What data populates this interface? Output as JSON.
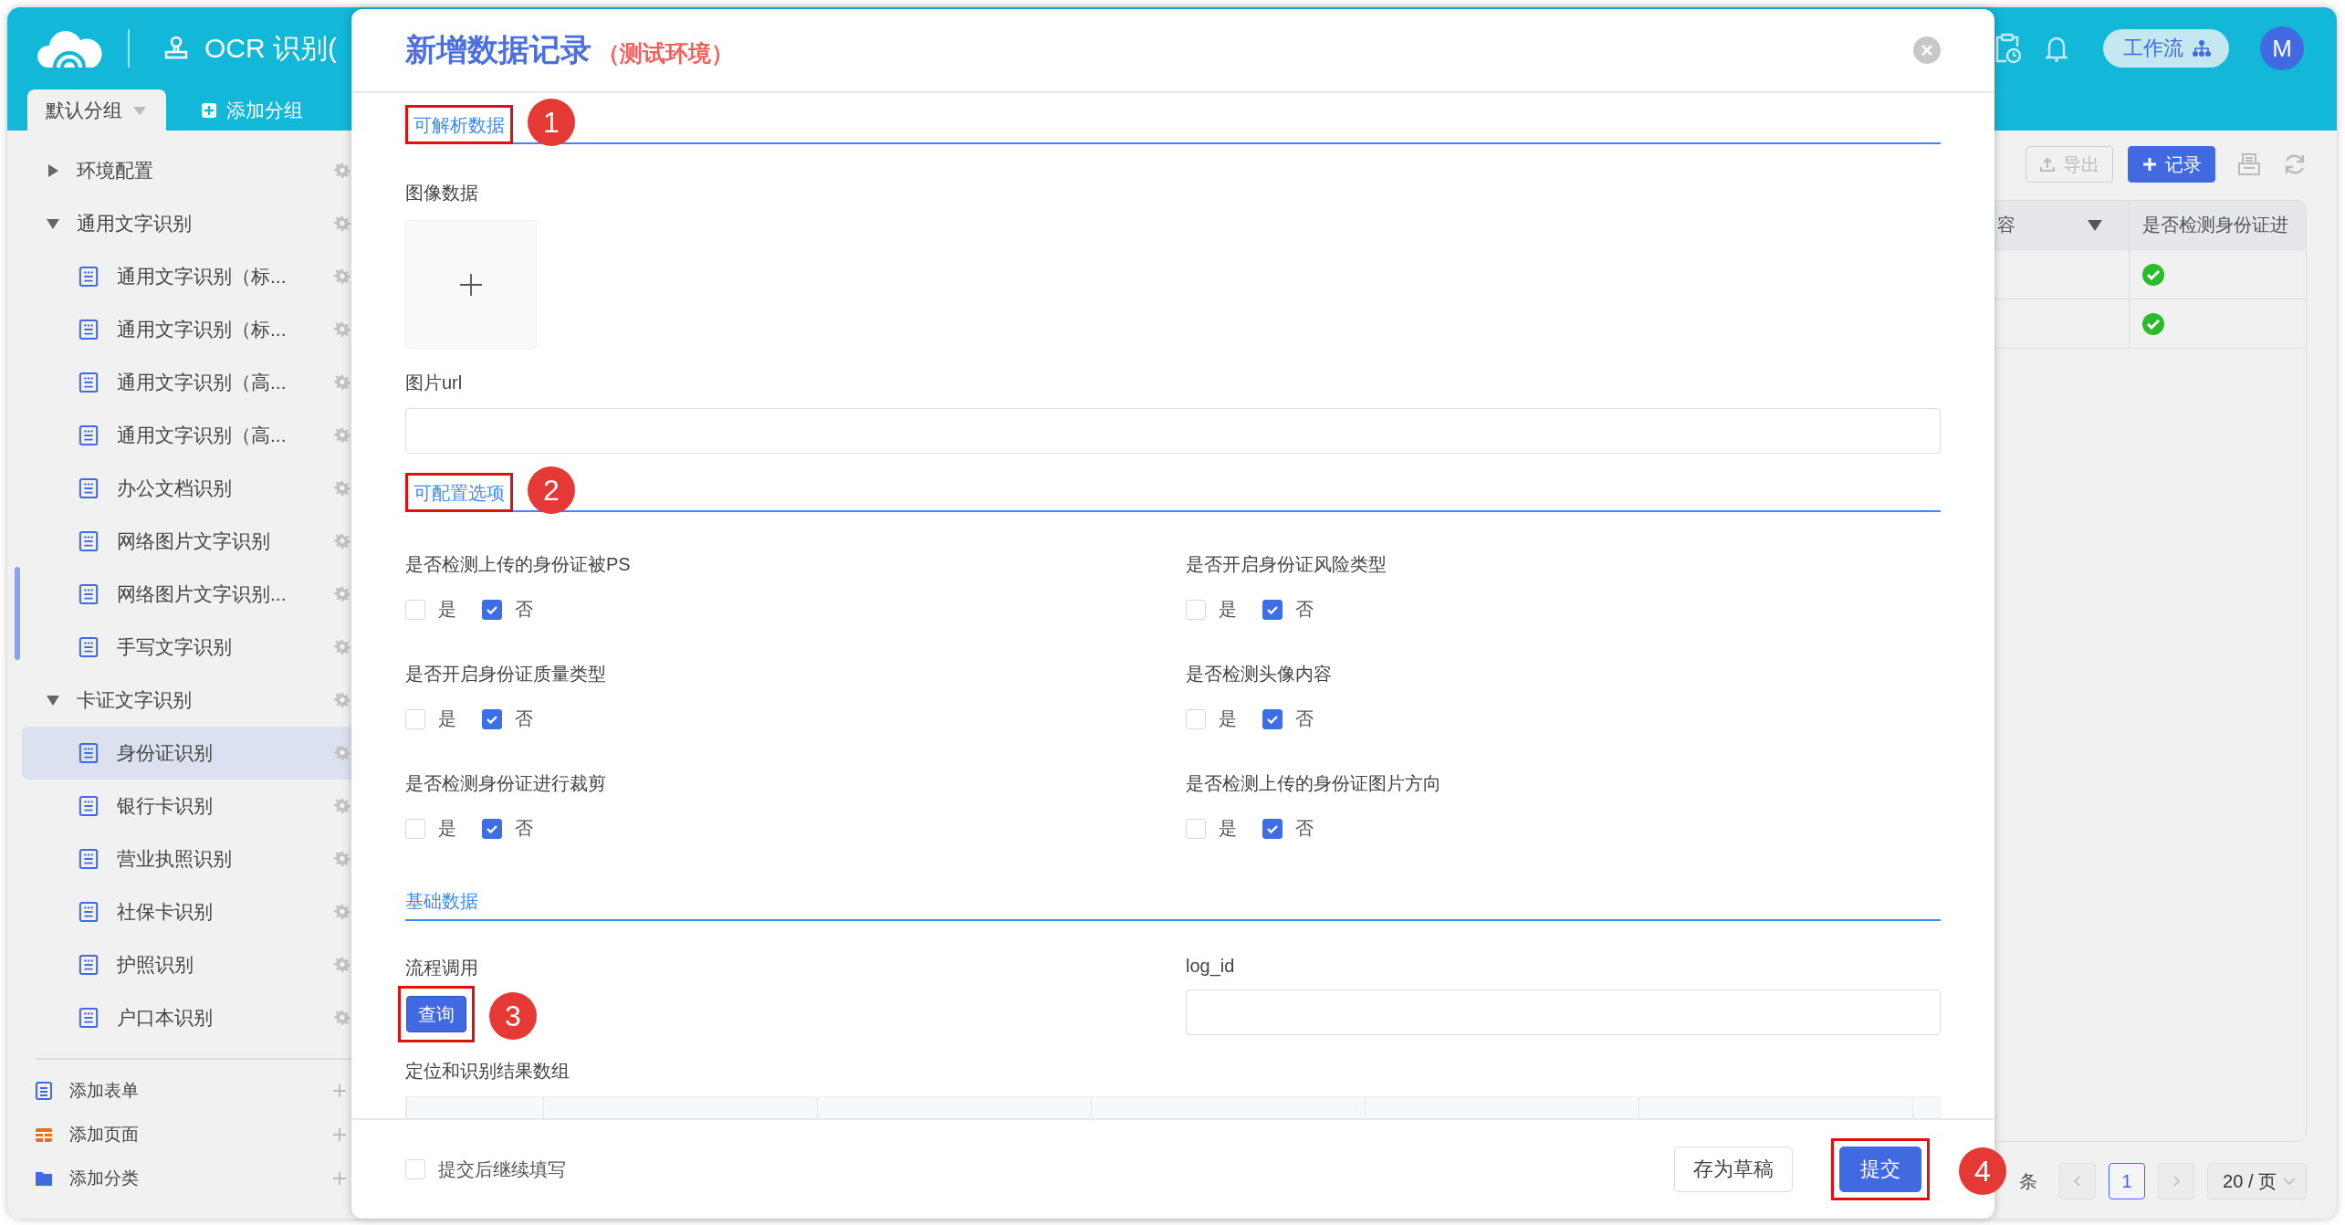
{
  "app": {
    "title": "OCR 识别(",
    "tabs": [
      {
        "label": "默认分组",
        "selected": true,
        "kind": "group"
      },
      {
        "label": "添加分组",
        "selected": false,
        "kind": "add"
      }
    ],
    "workflow": "工作流",
    "avatar": "M"
  },
  "sidebar": {
    "tree": [
      {
        "label": "环境配置",
        "expanded": false
      },
      {
        "label": "通用文字识别",
        "expanded": true,
        "children": [
          {
            "label": "通用文字识别（标...",
            "selected": false
          },
          {
            "label": "通用文字识别（标...",
            "selected": false
          },
          {
            "label": "通用文字识别（高...",
            "selected": false
          },
          {
            "label": "通用文字识别（高...",
            "selected": false
          },
          {
            "label": "办公文档识别",
            "selected": false
          },
          {
            "label": "网络图片文字识别",
            "selected": false
          },
          {
            "label": "网络图片文字识别...",
            "selected": false
          },
          {
            "label": "手写文字识别",
            "selected": false
          }
        ]
      },
      {
        "label": "卡证文字识别",
        "expanded": true,
        "children": [
          {
            "label": "身份证识别",
            "selected": true
          },
          {
            "label": "银行卡识别",
            "selected": false
          },
          {
            "label": "营业执照识别",
            "selected": false
          },
          {
            "label": "社保卡识别",
            "selected": false
          },
          {
            "label": "护照识别",
            "selected": false
          },
          {
            "label": "户口本识别",
            "selected": false
          }
        ]
      }
    ],
    "footer": [
      {
        "label": "添加表单",
        "kind": "form"
      },
      {
        "label": "添加页面",
        "kind": "page"
      },
      {
        "label": "添加分类",
        "kind": "folder"
      }
    ]
  },
  "toolbar": {
    "buttons": [
      {
        "label": "导出",
        "kind": "export"
      },
      {
        "label": "记录",
        "kind": "add"
      }
    ]
  },
  "table": {
    "columns": [
      {
        "label": "容",
        "dropdown": true
      },
      {
        "label": "是否检测身份证进"
      }
    ],
    "rows": [
      {
        "column_2": true
      },
      {
        "column_2": true
      }
    ]
  },
  "pagination": {
    "total": "条",
    "pages": [
      {
        "label": "1",
        "selected": true
      }
    ],
    "page_size": "20 / 页"
  },
  "modal": {
    "title": "新增数据记录",
    "subtitle": "（测试环境）",
    "sections": [
      {
        "title": "可解析数据",
        "marker": "1",
        "fields": [
          {
            "kind": "upload",
            "label": "图像数据",
            "full_width": true
          },
          {
            "kind": "text",
            "label": "图片url",
            "full_width": true
          }
        ]
      },
      {
        "title": "可配置选项",
        "marker": "2",
        "fields": [
          {
            "kind": "choice",
            "label": "是否检测上传的身份证被PS",
            "options": [
              {
                "label": "是",
                "checked": false
              },
              {
                "label": "否",
                "checked": true
              }
            ]
          },
          {
            "kind": "choice",
            "label": "是否开启身份证风险类型",
            "options": [
              {
                "label": "是",
                "checked": false
              },
              {
                "label": "否",
                "checked": true
              }
            ]
          },
          {
            "kind": "choice",
            "label": "是否开启身份证质量类型",
            "options": [
              {
                "label": "是",
                "checked": false
              },
              {
                "label": "否",
                "checked": true
              }
            ]
          },
          {
            "kind": "choice",
            "label": "是否检测头像内容",
            "options": [
              {
                "label": "是",
                "checked": false
              },
              {
                "label": "否",
                "checked": true
              }
            ]
          },
          {
            "kind": "choice",
            "label": "是否检测身份证进行裁剪",
            "options": [
              {
                "label": "是",
                "checked": false
              },
              {
                "label": "否",
                "checked": true
              }
            ]
          },
          {
            "kind": "choice",
            "label": "是否检测上传的身份证图片方向",
            "options": [
              {
                "label": "是",
                "checked": false
              },
              {
                "label": "否",
                "checked": true
              }
            ]
          }
        ]
      },
      {
        "title": "基础数据",
        "fields": [
          {
            "kind": "button",
            "label": "流程调用",
            "button": "查询",
            "marker": "3"
          },
          {
            "kind": "text",
            "label": "log_id"
          },
          {
            "kind": "table",
            "label": "定位和识别结果数组",
            "full_width": true
          }
        ]
      }
    ],
    "footer": {
      "continue": {
        "label": "提交后继续填写",
        "checked": false
      },
      "buttons": [
        {
          "label": "存为草稿",
          "kind": "default"
        },
        {
          "label": "提交",
          "kind": "primary",
          "marker": "4"
        }
      ]
    }
  }
}
